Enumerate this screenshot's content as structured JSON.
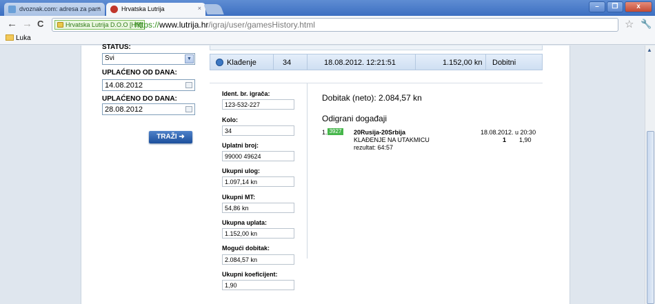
{
  "browser": {
    "tabs": [
      {
        "title": "dvoznak.com: adresa za parn",
        "active": false
      },
      {
        "title": "Hrvatska Lutrija",
        "active": true
      }
    ],
    "close_glyph": "×",
    "window_buttons": {
      "minimize": "–",
      "maximize": "❐",
      "close": "x"
    },
    "nav": {
      "back": "←",
      "forward": "→",
      "reload": "C"
    },
    "security_label": "Hrvatska Lutrija D.O.O [HR]",
    "url": {
      "scheme": "https://",
      "host": "www.lutrija.hr",
      "path": "/igraj/user/gamesHistory.html"
    },
    "bookmarks": [
      {
        "label": "Luka"
      }
    ],
    "icons": [
      "lock-icon",
      "star-icon",
      "wrench-icon",
      "folder-icon"
    ]
  },
  "filter": {
    "status_label": "STATUS:",
    "status_value": "Svi",
    "from_label": "UPLAĆENO OD DANA:",
    "from_value": "14.08.2012",
    "to_label": "UPLAĆENO DO DANA:",
    "to_value": "28.08.2012",
    "search_button": "TRAŽI"
  },
  "result_row": {
    "game": "Klađenje",
    "round": "34",
    "datetime": "18.08.2012. 12:21:51",
    "amount": "1.152,00 kn",
    "status": "Dobitni"
  },
  "detail": {
    "fields": [
      {
        "label": "Ident. br. igrača:",
        "value": "123-532-227"
      },
      {
        "label": "Kolo:",
        "value": "34"
      },
      {
        "label": "Uplatni broj:",
        "value": "99000 49624"
      },
      {
        "label": "Ukupni ulog:",
        "value": "1.097,14 kn"
      },
      {
        "label": "Ukupni MT:",
        "value": "54,86 kn"
      },
      {
        "label": "Ukupna uplata:",
        "value": "1.152,00 kn"
      },
      {
        "label": "Mogući dobitak:",
        "value": "2.084,57 kn"
      },
      {
        "label": "Ukupni koeficijent:",
        "value": "1,90"
      }
    ],
    "net_win": "Dobitak (neto): 2.084,57 kn",
    "events_title": "Odigrani događaji",
    "event": {
      "num": "1.",
      "code": "3927",
      "match": "20Rusija-20Srbija",
      "bet_type": "KLAĐENJE NA UTAKMICU",
      "result": "rezultat: 64:57",
      "date": "18.08.2012. u 20:30",
      "tip": "1",
      "odd": "1,90"
    }
  },
  "colors": {
    "accent": "#1c4f9c",
    "badge": "#46b64b",
    "row": "#cfdff2"
  }
}
